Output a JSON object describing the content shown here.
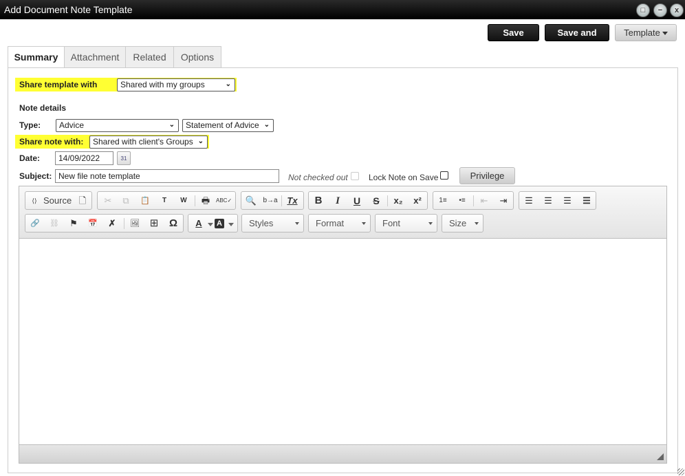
{
  "window": {
    "title": "Add Document Note Template",
    "controls": {
      "maximize": "□",
      "minimize": "−",
      "close": "x"
    }
  },
  "actions": {
    "save": "Save",
    "save_close": "Save and Close",
    "template": "Template"
  },
  "tabs": [
    {
      "label": "Summary",
      "active": true
    },
    {
      "label": "Attachment",
      "active": false
    },
    {
      "label": "Related",
      "active": false
    },
    {
      "label": "Options",
      "active": false
    }
  ],
  "form": {
    "share_template_label": "Share template with",
    "share_template_value": "Shared with my groups",
    "note_details_heading": "Note details",
    "type_label": "Type:",
    "type_value": "Advice",
    "subtype_value": "Statement of Advice",
    "share_note_label": "Share note with:",
    "share_note_value": "Shared with client's Groups",
    "date_label": "Date:",
    "date_value": "14/09/2022",
    "calendar_glyph": "31",
    "subject_label": "Subject:",
    "subject_value": "New file note template",
    "checkout_status": "Not checked out",
    "checkout_checked": false,
    "lock_label": "Lock Note on Save",
    "lock_checked": false,
    "privilege_button": "Privilege"
  },
  "editor": {
    "source_label": "Source",
    "glyphs": {
      "source": "⟨⟩",
      "newpage": "🗋",
      "cut": "✂",
      "copy": "⧉",
      "paste": "📋",
      "paste_text": "T",
      "paste_word": "W",
      "print": "🖶",
      "spell": "ABC✓",
      "find": "🔍",
      "replace": "b→a",
      "remove_format": "Tx",
      "bold": "B",
      "italic": "I",
      "underline": "U",
      "strike": "S",
      "subscript": "x₂",
      "superscript": "x²",
      "numbered": "1≡",
      "bulleted": "•≡",
      "outdent": "⇤",
      "indent": "⇥",
      "align_left": "☰",
      "align_center": "☰",
      "align_right": "☰",
      "justify": "☰",
      "link": "🔗",
      "unlink": "⛓",
      "anchor": "⚑",
      "date": "📅",
      "tools": "✗",
      "image": "🖼",
      "table": "⊞",
      "special_char": "Ω",
      "text_color": "A",
      "bg_color": "A"
    },
    "combos": {
      "styles": "Styles",
      "format": "Format",
      "font": "Font",
      "size": "Size"
    },
    "content": ""
  },
  "colors": {
    "highlight": "#ffff33",
    "titlebar": "#000000"
  }
}
